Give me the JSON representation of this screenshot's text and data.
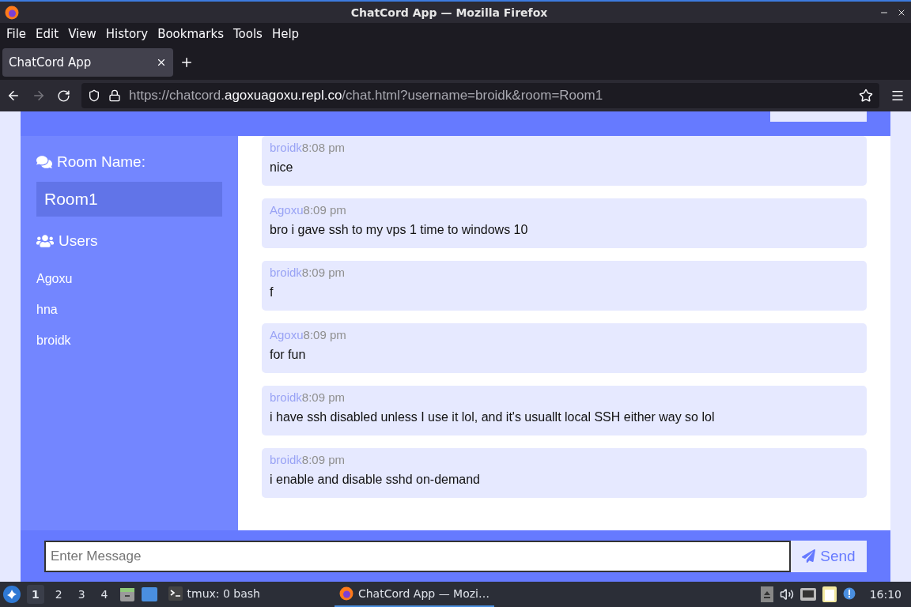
{
  "window": {
    "title": "ChatCord App — Mozilla Firefox"
  },
  "menu": [
    "File",
    "Edit",
    "View",
    "History",
    "Bookmarks",
    "Tools",
    "Help"
  ],
  "tabs": [
    {
      "label": "ChatCord App",
      "selected": true
    }
  ],
  "url": {
    "scheme": "https://chatcord.",
    "host": "agoxuagoxu.repl.co",
    "path": "/chat.html?username=broidk&room=Room1"
  },
  "sidebar": {
    "room_label": "Room Name:",
    "room_name": "Room1",
    "users_label": "Users",
    "users": [
      "Agoxu",
      "hna",
      "broidk"
    ]
  },
  "messages": [
    {
      "user": "broidk",
      "time": "8:08 pm",
      "text": "nice"
    },
    {
      "user": "Agoxu",
      "time": "8:09 pm",
      "text": "bro i gave ssh to my vps 1 time to windows 10"
    },
    {
      "user": "broidk",
      "time": "8:09 pm",
      "text": "f"
    },
    {
      "user": "Agoxu",
      "time": "8:09 pm",
      "text": "for fun"
    },
    {
      "user": "broidk",
      "time": "8:09 pm",
      "text": "i have ssh disabled unless I use it lol, and it's usuallt local SSH either way so lol"
    },
    {
      "user": "broidk",
      "time": "8:09 pm",
      "text": "i enable and disable sshd on-demand"
    }
  ],
  "message_form": {
    "placeholder": "Enter Message",
    "button": "Send"
  },
  "taskbar": {
    "workspaces": [
      {
        "label": "1",
        "selected": true
      },
      {
        "label": "2",
        "selected": false
      },
      {
        "label": "3",
        "selected": false
      },
      {
        "label": "4",
        "selected": false
      }
    ],
    "tasks": [
      {
        "kind": "terminal",
        "label": "tmux: 0 bash",
        "selected": false
      },
      {
        "kind": "browser",
        "label": "ChatCord App — Mozi…",
        "selected": true
      }
    ],
    "clock": "16:10"
  }
}
